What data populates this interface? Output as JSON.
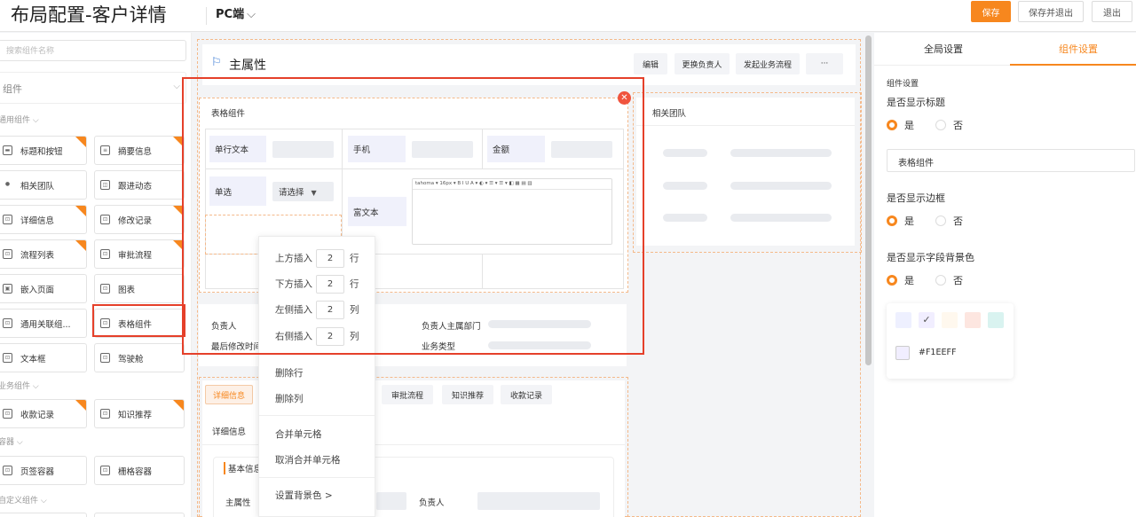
{
  "header": {
    "title": "布局配置-客户详情",
    "device": "PC端",
    "save": "保存",
    "save_exit": "保存并退出",
    "exit": "退出"
  },
  "left_panel": {
    "search_placeholder": "搜索组件名称",
    "group_label": "组件",
    "categories": {
      "general": "通用组件",
      "business": "业务组件",
      "container": "容器",
      "custom": "自定义组件"
    },
    "items": [
      "标题和按钮",
      "摘要信息",
      "相关团队",
      "跟进动态",
      "详细信息",
      "修改记录",
      "流程列表",
      "审批流程",
      "嵌入页面",
      "图表",
      "通用关联组...",
      "表格组件",
      "文本框",
      "驾驶舱",
      "收款记录",
      "知识推荐",
      "页签容器",
      "栅格容器"
    ]
  },
  "main_attr": {
    "title": "主属性",
    "buttons": [
      "编辑",
      "更换负责人",
      "发起业务流程",
      "···"
    ]
  },
  "table_component": {
    "title": "表格组件",
    "cells": {
      "text": "单行文本",
      "phone": "手机",
      "amount": "金额",
      "single_select": "单选",
      "select_placeholder": "请选择",
      "rich_text": "富文本"
    },
    "rte_toolbar": "tahoma ▾ 16px ▾ B I U A ▾ ◐ ▾ ☰ ▾ ☰ ▾ ◧ ▦ ▤ ▥"
  },
  "related_team": {
    "title": "相关团队"
  },
  "info_card": {
    "owner": "负责人",
    "last_modified": "最后修改时间",
    "owner_dept": "负责人主属部门",
    "biz_type": "业务类型"
  },
  "tabs_card": {
    "tabs": [
      "详细信息",
      "审批流程",
      "知识推荐",
      "收款记录"
    ],
    "subtitle": "详细信息",
    "basic_info": "基本信息",
    "primary": "主属性",
    "owner": "负责人"
  },
  "context_menu": {
    "insert_above": "上方插入",
    "insert_above_val": "2",
    "row_unit_1": "行",
    "insert_below": "下方插入",
    "insert_below_val": "2",
    "row_unit_2": "行",
    "insert_left": "左侧插入",
    "insert_left_val": "2",
    "col_unit_1": "列",
    "insert_right": "右侧插入",
    "insert_right_val": "2",
    "col_unit_2": "列",
    "delete_row": "删除行",
    "delete_col": "删除列",
    "merge": "合并单元格",
    "unmerge": "取消合并单元格",
    "set_bg": "设置背景色 >"
  },
  "right_panel": {
    "tabs": [
      "全局设置",
      "组件设置"
    ],
    "active_tab": "组件设置",
    "section_title": "组件设置",
    "show_title": "是否显示标题",
    "yes": "是",
    "no": "否",
    "title_value": "表格组件",
    "show_border": "是否显示边框",
    "show_field_bg": "是否显示字段背景色",
    "selected_color": "#F1EEFF",
    "swatches": [
      "#eef0ff",
      "#f1eeff",
      "#fff8ee",
      "#fde6e0",
      "#d9f3f0"
    ]
  },
  "colors": {
    "accent": "#f7871e",
    "highlight_red": "#e5402a"
  }
}
